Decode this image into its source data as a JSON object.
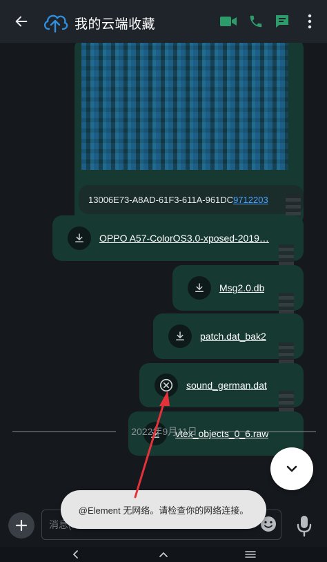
{
  "header": {
    "room_name": "我的云端收藏",
    "avatar_icon": "cloud-upload-icon",
    "accent_color": "#2d9b6a"
  },
  "timeline": {
    "text_message": {
      "prefix": "13006E73-A8AD-61F3-611A-961DC",
      "link": "9712203"
    },
    "files": [
      {
        "name": "OPPO A57-ColorOS3.0-xposed-2019…",
        "status": "download"
      },
      {
        "name": "Msg2.0.db",
        "status": "download"
      },
      {
        "name": "patch.dat_bak2",
        "status": "download"
      },
      {
        "name": "sound_german.dat",
        "status": "failed"
      },
      {
        "name": "vtex_objects_0_6.raw",
        "status": "download"
      }
    ],
    "date_separator": "2022年9月11日"
  },
  "composer": {
    "placeholder": "消息(..."
  },
  "toast": {
    "message": "@Element 无网络。请检查你的网络连接。"
  },
  "colors": {
    "bubble": "#163a32",
    "annotation": "#e5323a",
    "link": "#4da3ff"
  }
}
